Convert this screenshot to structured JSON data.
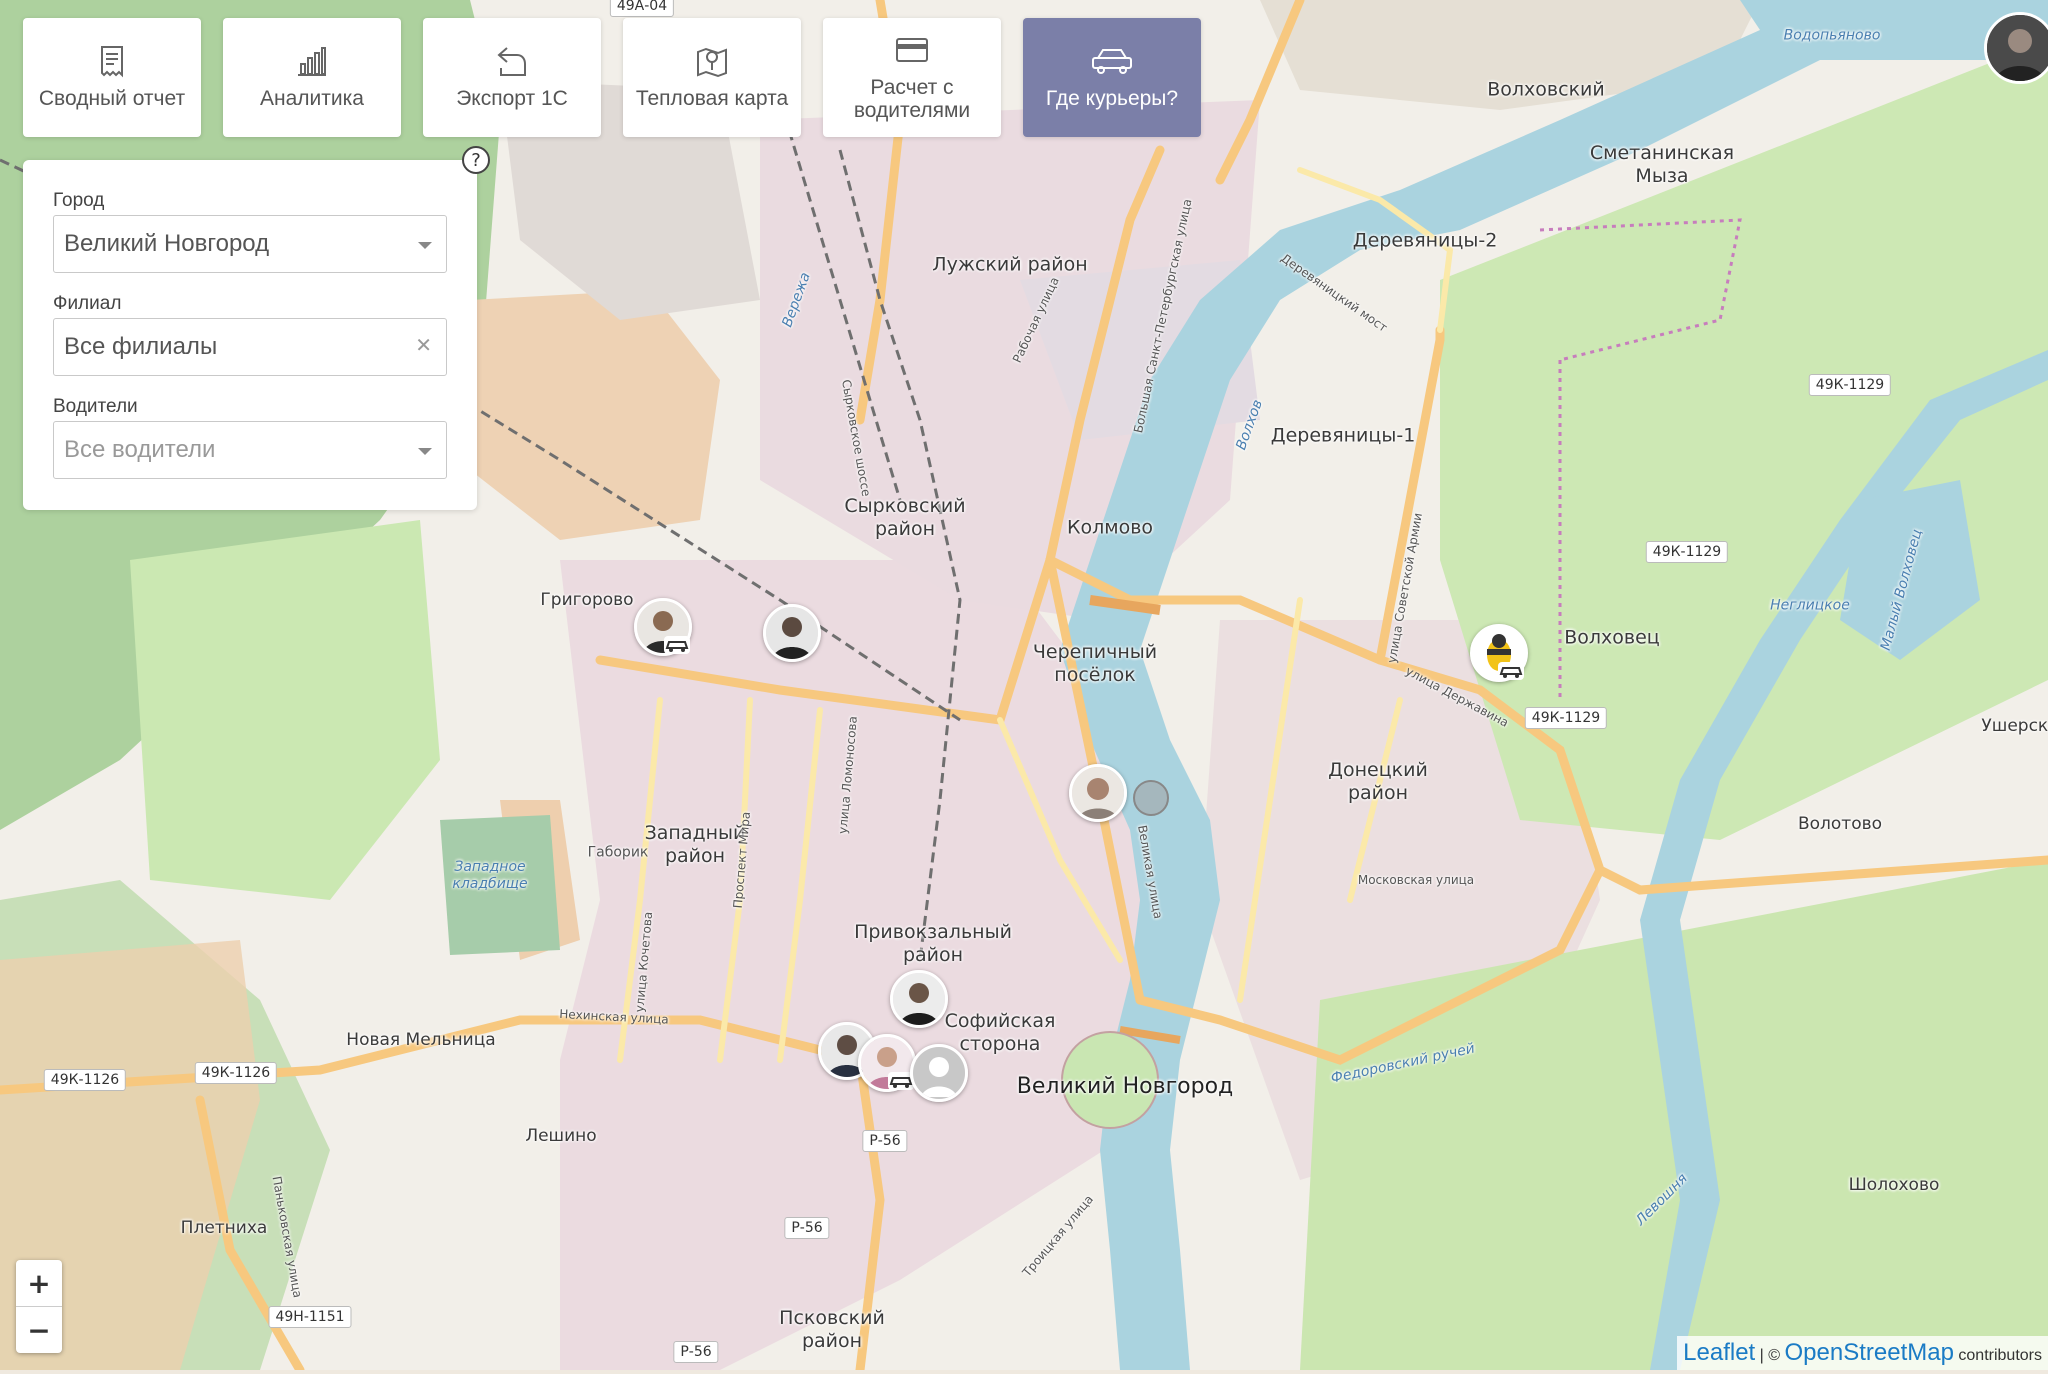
{
  "toolbar": {
    "items": [
      {
        "label": "Сводный отчет",
        "icon": "receipt-icon",
        "active": false
      },
      {
        "label": "Аналитика",
        "icon": "bar-chart-icon",
        "active": false
      },
      {
        "label": "Экспорт 1С",
        "icon": "export-icon",
        "active": false
      },
      {
        "label": "Тепловая карта",
        "icon": "map-pin-icon",
        "active": false
      },
      {
        "label": "Расчет с водителями",
        "icon": "credit-card-icon",
        "active": false
      },
      {
        "label": "Где курьеры?",
        "icon": "car-icon",
        "active": true
      }
    ]
  },
  "filters": {
    "help": "?",
    "city_label": "Город",
    "city_value": "Великий Новгород",
    "branch_label": "Филиал",
    "branch_value": "Все филиалы",
    "drivers_label": "Водители",
    "drivers_placeholder": "Все водители"
  },
  "map": {
    "places": [
      {
        "name": "Лужский район",
        "kind": "district"
      },
      {
        "name": "Сырковский район",
        "kind": "district"
      },
      {
        "name": "Колмово",
        "kind": "district"
      },
      {
        "name": "Черепичный посёлок",
        "kind": "district"
      },
      {
        "name": "Григорово",
        "kind": "small"
      },
      {
        "name": "Западный район",
        "kind": "district"
      },
      {
        "name": "Привокзальный район",
        "kind": "district"
      },
      {
        "name": "Софийская сторона",
        "kind": "district"
      },
      {
        "name": "Великий Новгород",
        "kind": "city"
      },
      {
        "name": "Новая Мельница",
        "kind": "small"
      },
      {
        "name": "Лешино",
        "kind": "small"
      },
      {
        "name": "Плетниха",
        "kind": "small"
      },
      {
        "name": "Псковский район",
        "kind": "district"
      },
      {
        "name": "Волховский",
        "kind": "district"
      },
      {
        "name": "Сметанинская Мыза",
        "kind": "district"
      },
      {
        "name": "Деревяницы-2",
        "kind": "district"
      },
      {
        "name": "Деревяницы-1",
        "kind": "district"
      },
      {
        "name": "Волховец",
        "kind": "district"
      },
      {
        "name": "Донецкий район",
        "kind": "district"
      },
      {
        "name": "Волотово",
        "kind": "small"
      },
      {
        "name": "Ушерско",
        "kind": "small"
      },
      {
        "name": "Шолохово",
        "kind": "small"
      },
      {
        "name": "Водопьяново",
        "kind": "water"
      },
      {
        "name": "Западное кладбище",
        "kind": "water"
      },
      {
        "name": "Габорик",
        "kind": "small"
      },
      {
        "name": "Волхов",
        "kind": "water"
      },
      {
        "name": "Неглицкое",
        "kind": "water"
      },
      {
        "name": "Малый Волховец",
        "kind": "water"
      },
      {
        "name": "Федоровский ручей",
        "kind": "water"
      },
      {
        "name": "Левошня",
        "kind": "water"
      },
      {
        "name": "Вережа",
        "kind": "water"
      },
      {
        "name": "Московская улица",
        "kind": "street"
      },
      {
        "name": "Нехинская улица",
        "kind": "street"
      },
      {
        "name": "Рабочая улица",
        "kind": "street"
      },
      {
        "name": "Деревяницкий мост",
        "kind": "street"
      },
      {
        "name": "улица Державина",
        "kind": "street"
      },
      {
        "name": "Троицкая улица",
        "kind": "street"
      },
      {
        "name": "Великая улица",
        "kind": "street"
      },
      {
        "name": "улица Ломоносова",
        "kind": "street"
      },
      {
        "name": "Проспект Мира",
        "kind": "street"
      },
      {
        "name": "улица Кочетова",
        "kind": "street"
      },
      {
        "name": "Большая Санкт-Петербургская улица",
        "kind": "street"
      },
      {
        "name": "Сырковское шоссе",
        "kind": "street"
      },
      {
        "name": "Паньковская улица",
        "kind": "street"
      },
      {
        "name": "улица Советской Армии",
        "kind": "street"
      }
    ],
    "shields": [
      "49А-04",
      "49К-1129",
      "49К-1129",
      "49К-1129",
      "49К-1126",
      "49К-1126",
      "49Н-1151",
      "Р-56",
      "Р-56",
      "Р-56"
    ],
    "couriers": [
      {
        "name": "courier-1",
        "tone": "#8a6a52",
        "driving": true
      },
      {
        "name": "courier-2",
        "tone": "#5b4a40",
        "driving": false
      },
      {
        "name": "courier-3",
        "tone": "#a88470",
        "driving": false
      },
      {
        "name": "courier-4",
        "tone": "#6a5547",
        "driving": false
      },
      {
        "name": "courier-5",
        "tone": "#5e4d44",
        "driving": false
      },
      {
        "name": "courier-6",
        "tone": "#c27a9a",
        "driving": true
      },
      {
        "name": "courier-7",
        "tone": "#bdbdbd",
        "driving": false
      },
      {
        "name": "courier-8",
        "tone": "#f2c318",
        "driving": true
      }
    ]
  },
  "zoom": {
    "in": "+",
    "out": "−"
  },
  "attribution": {
    "leaflet": "Leaflet",
    "sep": "| ©",
    "osm": "OpenStreetMap",
    "suffix": "contributors"
  },
  "colors": {
    "active_tab": "#7b7fa8",
    "water": "#aad3df",
    "park": "#c8e6b0",
    "forest": "#add19e",
    "road": "#f7c87f",
    "urban": "#e8dcd6"
  }
}
